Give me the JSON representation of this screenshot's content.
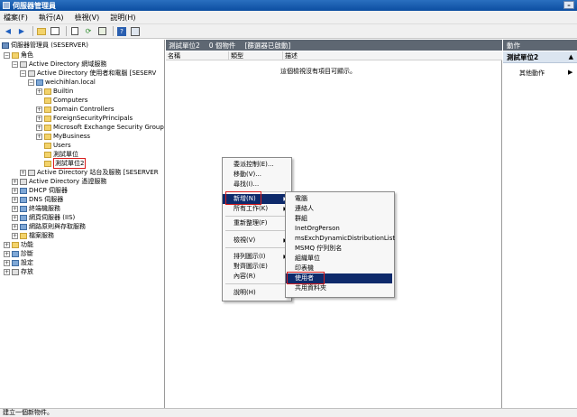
{
  "window": {
    "title": "伺服器管理員"
  },
  "menu": [
    "檔案(F)",
    "執行(A)",
    "檢視(V)",
    "說明(H)"
  ],
  "tree": {
    "root": "伺服器管理員 (SESERVER)",
    "roles": "角色",
    "ad": "Active Directory 網域服務",
    "aduc": "Active Directory 使用者和電腦 [SESERV",
    "domain": "weichihlan.local",
    "builtin": "Builtin",
    "computers": "Computers",
    "dc": "Domain Controllers",
    "fsp": "ForeignSecurityPrincipals",
    "exchange": "Microsoft Exchange Security Group",
    "mybusiness": "MyBusiness",
    "users": "Users",
    "test_unit": "測試單位",
    "test_unit2": "測試單位2",
    "ad_sites": "Active Directory 站台及服務 [SESERVER",
    "adcs": "Active Directory 憑證服務",
    "dhcp": "DHCP 伺服器",
    "dns": "DNS 伺服器",
    "terminal": "終端機服務",
    "iis": "網頁伺服器 (IIS)",
    "nps": "網路原則與存取服務",
    "file": "檔案服務",
    "features": "功能",
    "diagnostics": "診斷",
    "config": "設定",
    "storage": "存放"
  },
  "middle": {
    "title": "測試單位2",
    "count": "0 個物件",
    "filter": "[篩選器已啟動]",
    "columns": [
      "名稱",
      "類型",
      "描述"
    ],
    "empty": "這個檢視沒有項目可顯示。"
  },
  "actions": {
    "header": "動作",
    "section": "測試單位2",
    "more": "其他動作"
  },
  "context_menu": [
    "委派控制(E)...",
    "移動(V)...",
    "尋找(I)...",
    "新增(N)",
    "所有工作(K)",
    "重新整理(F)",
    "檢視(V)",
    "排列圖示(I)",
    "對齊圖示(E)",
    "內容(R)",
    "說明(H)"
  ],
  "submenu": [
    "電腦",
    "連絡人",
    "群組",
    "InetOrgPerson",
    "msExchDynamicDistributionList",
    "MSMQ 佇列別名",
    "組織單位",
    "印表機",
    "使用者",
    "共用資料夾"
  ],
  "status": "建立一個新物件。",
  "colors": {
    "header": "#5e6772",
    "selected": "#0e2a6b",
    "highlight": "#d81c1c"
  }
}
